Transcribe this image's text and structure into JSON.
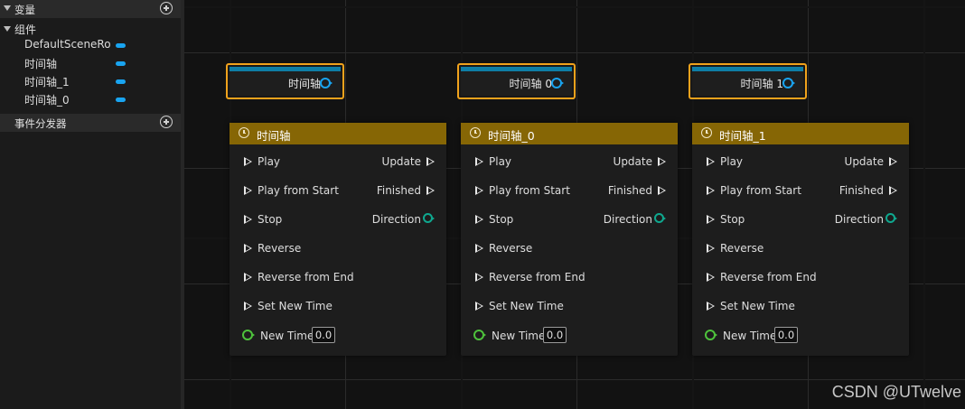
{
  "panel": {
    "variables_header": "变量",
    "components_header": "组件",
    "components": [
      "DefaultSceneRoot",
      "时间轴",
      "时间轴_1",
      "时间轴_0"
    ],
    "event_dispatchers_header": "事件分发器"
  },
  "variable_nodes": [
    {
      "label": "时间轴"
    },
    {
      "label": "时间轴 0"
    },
    {
      "label": "时间轴 1"
    }
  ],
  "timeline_nodes": [
    {
      "title": "时间轴",
      "inputs": [
        "Play",
        "Play from Start",
        "Stop",
        "Reverse",
        "Reverse from End",
        "Set New Time"
      ],
      "outputs": [
        "Update",
        "Finished",
        "Direction"
      ],
      "new_time_label": "New Time",
      "new_time_value": "0.0"
    },
    {
      "title": "时间轴_0",
      "inputs": [
        "Play",
        "Play from Start",
        "Stop",
        "Reverse",
        "Reverse from End",
        "Set New Time"
      ],
      "outputs": [
        "Update",
        "Finished",
        "Direction"
      ],
      "new_time_label": "New Time",
      "new_time_value": "0.0"
    },
    {
      "title": "时间轴_1",
      "inputs": [
        "Play",
        "Play from Start",
        "Stop",
        "Reverse",
        "Reverse from End",
        "Set New Time"
      ],
      "outputs": [
        "Update",
        "Finished",
        "Direction"
      ],
      "new_time_label": "New Time",
      "new_time_value": "0.0"
    }
  ],
  "watermark": "CSDN @UTwelve",
  "colors": {
    "node_header": "#866605",
    "variable_border": "#f0a21c",
    "object_pin": "#19a4f0",
    "direction_pin": "#0fa88f",
    "float_pin": "#4ec23c"
  }
}
